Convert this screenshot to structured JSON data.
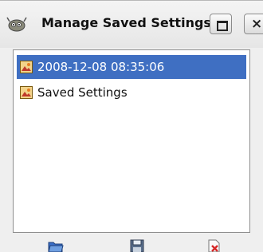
{
  "window": {
    "title": "Manage Saved Settings",
    "app_icon": "gimp-wilber-icon",
    "maximize_icon": "maximize-icon",
    "close_glyph": "×"
  },
  "settings_list": {
    "items": [
      {
        "label": "2008-12-08 08:35:06",
        "icon": "preset-image-icon",
        "selected": true
      },
      {
        "label": "Saved Settings",
        "icon": "preset-image-icon",
        "selected": false
      }
    ]
  },
  "toolbar": {
    "buttons": [
      {
        "name": "import",
        "icon": "folder-open-icon"
      },
      {
        "name": "export",
        "icon": "floppy-save-icon"
      },
      {
        "name": "delete",
        "icon": "delete-icon"
      }
    ]
  },
  "colors": {
    "selection": "#3f6fc2",
    "window_bg": "#efefef"
  }
}
